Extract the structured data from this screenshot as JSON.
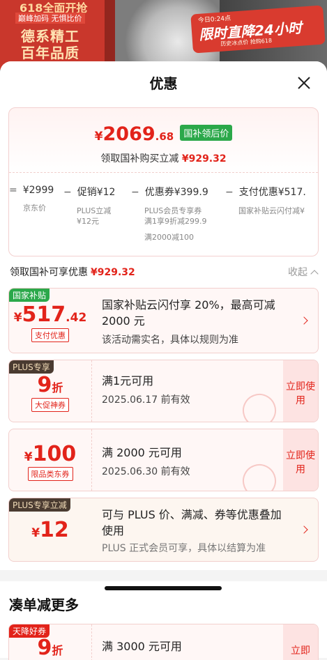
{
  "background": {
    "left_banner": [
      "618全面开抢",
      "巅峰加码 无惧比价",
      "德系精工",
      "百年品质"
    ],
    "promo_banner": [
      "今日0:24点",
      "限时直降24小时",
      "历史冰点价 抢购618"
    ]
  },
  "sheet": {
    "title": "优惠",
    "close_icon": "close-icon"
  },
  "summary": {
    "final_price": {
      "currency": "¥",
      "integer": "2069",
      "decimal": ".68"
    },
    "badge": "国补领后价",
    "line2_prefix": "领取国补购买立减",
    "line2_amount": "¥929.32",
    "breakdown": [
      {
        "op": "=",
        "top": "¥2999",
        "sub": [
          "京东价"
        ]
      },
      {
        "op": "−",
        "top": "促销¥12",
        "sub": [
          "PLUS立减",
          "¥12元"
        ]
      },
      {
        "op": "−",
        "top": "优惠券¥399.9",
        "sub": [
          "PLUS会员专享券",
          "满1享9折减299.9",
          "",
          "满2000减100"
        ]
      },
      {
        "op": "−",
        "top": "支付优惠¥517.",
        "sub": [
          "国家补贴云闪付减¥"
        ]
      }
    ]
  },
  "gov_section": {
    "label": "领取国补可享优惠",
    "amount": "¥929.32",
    "collapse": "收起"
  },
  "coupons": [
    {
      "tag": "国家补贴",
      "cur": "¥",
      "big": "517",
      "small": ".42",
      "unit": "",
      "label": "支付优惠",
      "main": "国家补贴云闪付享 20%，最高可减 2000 元",
      "sub": "该活动需实名，具体以规则为准",
      "action": "arrow"
    },
    {
      "tag": "PLUS专享",
      "cur": "",
      "big": "9",
      "small": "",
      "unit": "折",
      "label": "大促神券",
      "main": "满1元可用",
      "sub": "2025.06.17 前有效",
      "action": "立即使用"
    },
    {
      "tag": "",
      "cur": "¥",
      "big": "100",
      "small": "",
      "unit": "",
      "label": "限品类东券",
      "main": "满 2000 元可用",
      "sub": "2025.06.30 前有效",
      "action": "立即使用"
    },
    {
      "tag": "PLUS专享立减",
      "cur": "¥",
      "big": "12",
      "small": "",
      "unit": "",
      "label": "",
      "main": "可与 PLUS 价、满减、券等优惠叠加使用",
      "sub": "PLUS 正式会员可享，具体以结算为准",
      "action": "arrow"
    }
  ],
  "more_section": {
    "title": "凑单减更多",
    "coupon": {
      "tag": "天降好券",
      "big": "9",
      "unit": "折",
      "main": "满 3000 元可用",
      "action": "立即"
    }
  },
  "colors": {
    "accent_red": "#e2231a",
    "gov_green": "#2ba84a",
    "plus_brown": "#4a3b31"
  }
}
